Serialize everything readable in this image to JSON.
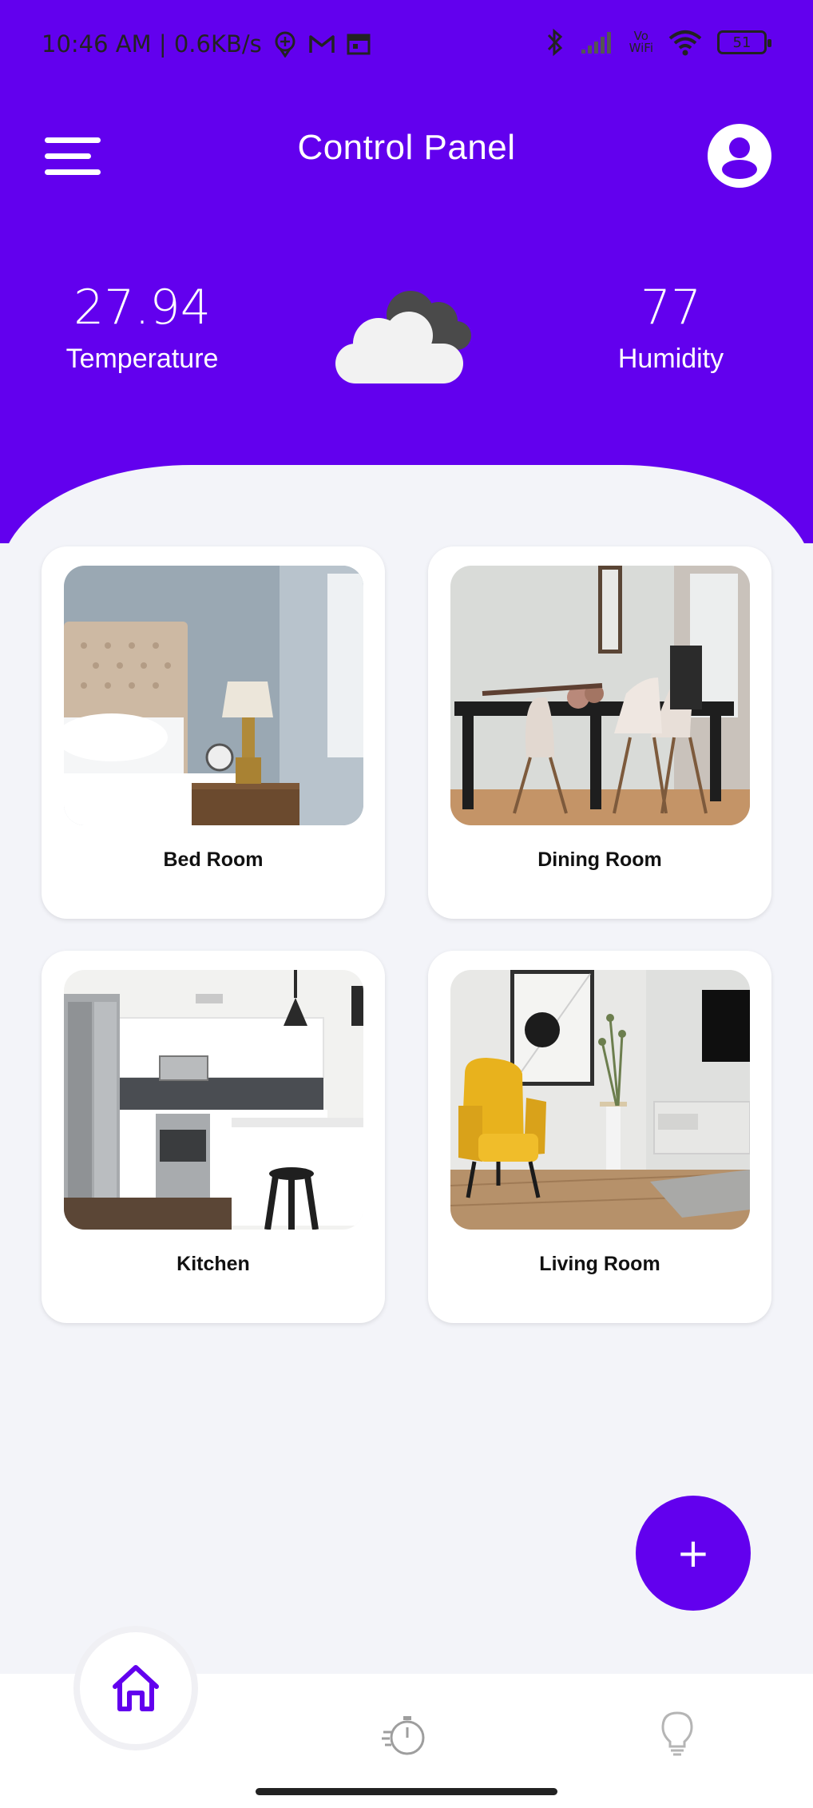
{
  "status_bar": {
    "time_speed": "10:46 AM | 0.6KB/s",
    "vowifi_top": "Vo",
    "vowifi_bottom": "WiFi",
    "battery": "51"
  },
  "app_bar": {
    "title": "Control Panel",
    "menu_icon": "hamburger-menu-icon",
    "profile_icon": "account-circle-icon"
  },
  "weather": {
    "temperature_value": "27.94",
    "temperature_label": "Temperature",
    "humidity_value": "77",
    "humidity_label": "Humidity",
    "icon": "cloudy-icon"
  },
  "rooms": [
    {
      "name": "Bed Room",
      "image": "bedroom-photo"
    },
    {
      "name": "Dining Room",
      "image": "dining-room-photo"
    },
    {
      "name": "Kitchen",
      "image": "kitchen-photo"
    },
    {
      "name": "Living Room",
      "image": "living-room-photo"
    }
  ],
  "fab": {
    "label": "+"
  },
  "bottom_nav": {
    "items": [
      {
        "icon": "home-icon",
        "active": true
      },
      {
        "icon": "timer-icon",
        "active": false
      },
      {
        "icon": "lightbulb-icon",
        "active": false
      }
    ]
  },
  "colors": {
    "primary": "#6200EE",
    "background": "#F3F4F9",
    "card": "#FFFFFF"
  }
}
